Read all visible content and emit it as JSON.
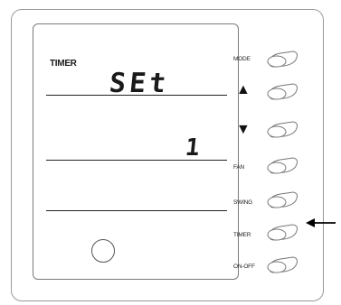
{
  "display": {
    "label": "TIMER",
    "segment_text": "SEt",
    "value": "1"
  },
  "buttons": [
    {
      "name": "mode",
      "label": "MODE",
      "icon": ""
    },
    {
      "name": "up",
      "label": "",
      "icon": "▲"
    },
    {
      "name": "down",
      "label": "",
      "icon": "▼"
    },
    {
      "name": "fan",
      "label": "FAN",
      "icon": ""
    },
    {
      "name": "swing",
      "label": "SWING",
      "icon": ""
    },
    {
      "name": "timer",
      "label": "TIMER",
      "icon": ""
    },
    {
      "name": "on-off",
      "label": "ON-OFF",
      "icon": ""
    }
  ],
  "colors": {
    "outline": "#9a9a9a",
    "ink": "#1a1a1a",
    "pointer": "#000000"
  }
}
